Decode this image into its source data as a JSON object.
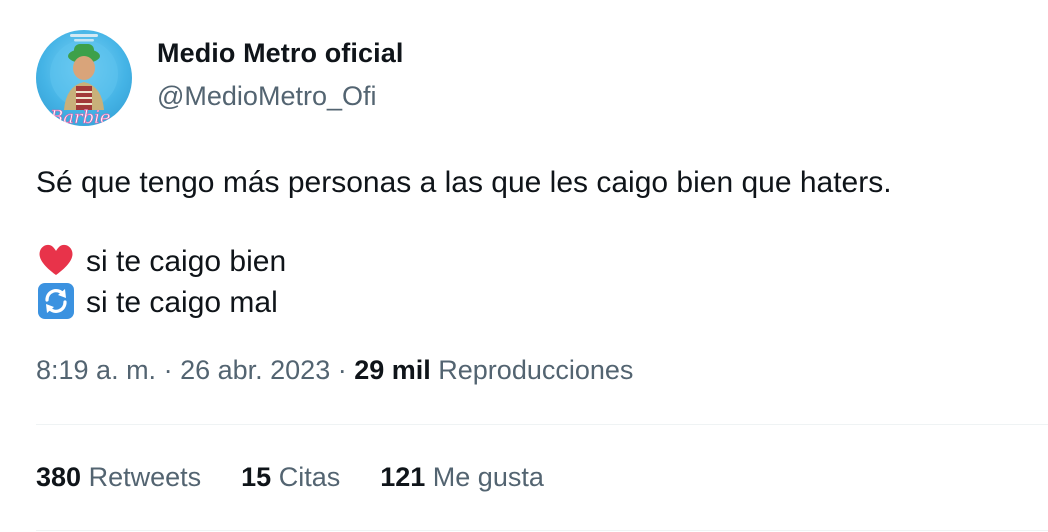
{
  "author": {
    "display_name": "Medio Metro oficial",
    "handle": "@MedioMetro_Ofi",
    "avatar_text": "Barbie"
  },
  "tweet": {
    "line1": "Sé que tengo más personas a las que les caigo bien que haters.",
    "line2_emoji": "heart-icon",
    "line2_text": "si te caigo bien",
    "line3_emoji": "repeat-icon",
    "line3_text": "si te caigo mal"
  },
  "meta": {
    "time": "8:19 a. m.",
    "sep1": " · ",
    "date": "26 abr. 2023",
    "sep2": " · ",
    "views_count": "29 mil",
    "views_label": "Reproducciones"
  },
  "stats": {
    "retweets_count": "380",
    "retweets_label": "Retweets",
    "quotes_count": "15",
    "quotes_label": "Citas",
    "likes_count": "121",
    "likes_label": "Me gusta"
  },
  "colors": {
    "primary_text": "#0f1419",
    "secondary_text": "#536471",
    "divider": "#eff3f4",
    "heart": "#e8334a",
    "repeat_bg": "#3b92e0"
  }
}
